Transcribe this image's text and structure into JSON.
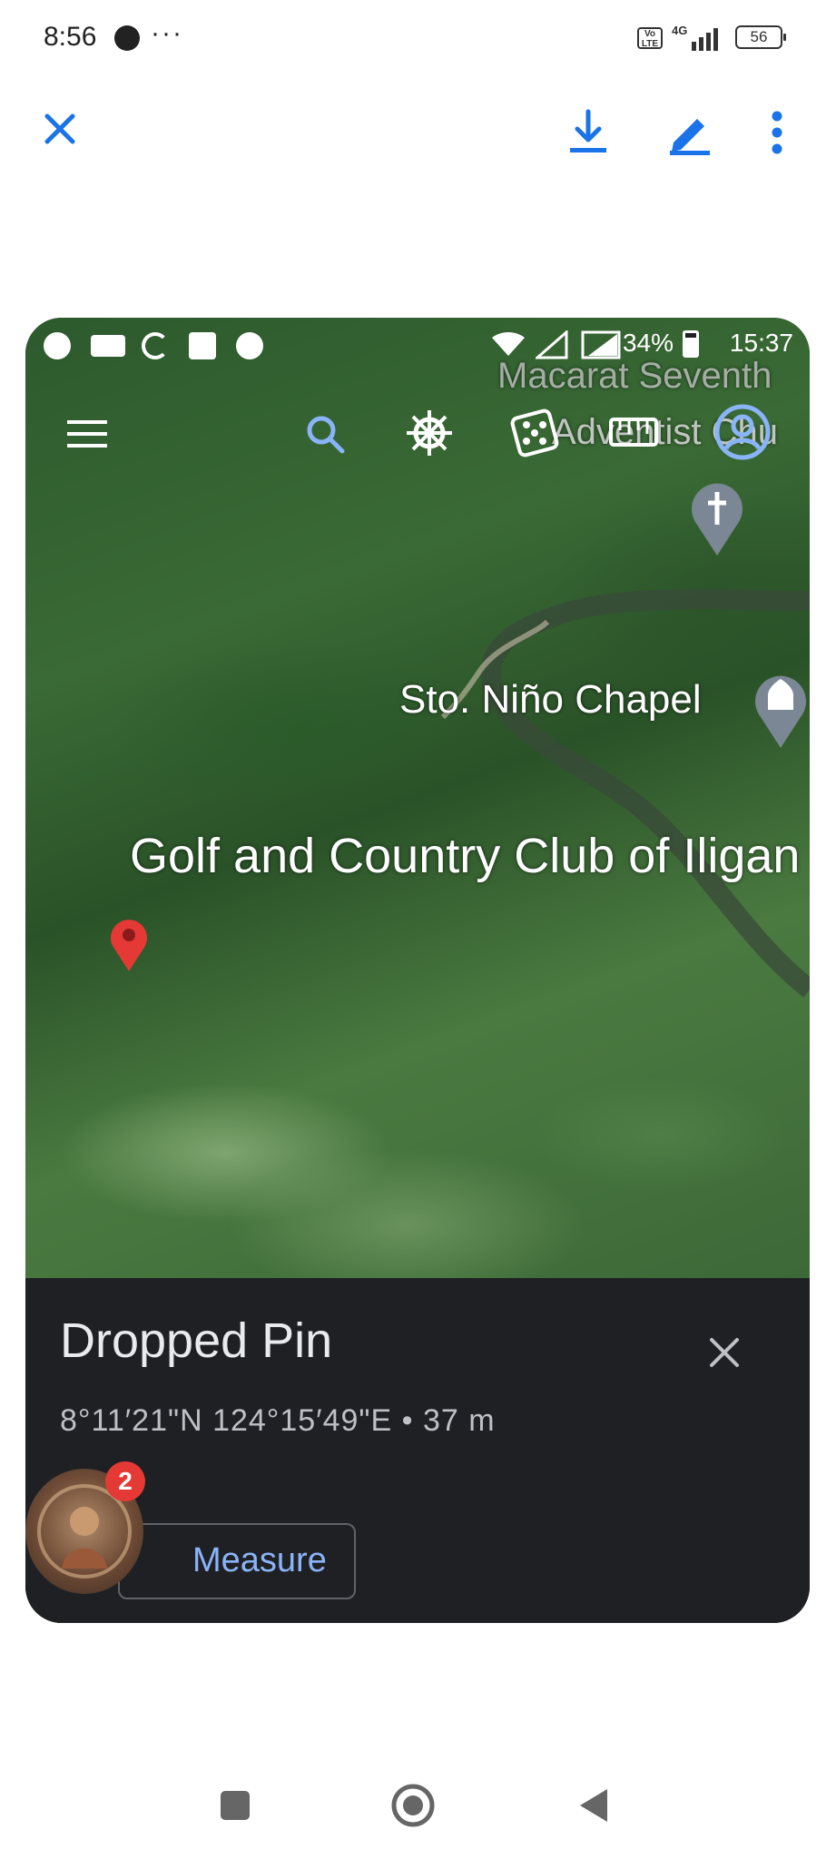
{
  "status_bar": {
    "time": "8:56",
    "overflow": "···",
    "volte": "Vo\nLTE",
    "network": "4G",
    "battery": "56"
  },
  "viewer_toolbar": {
    "close_icon": "close-icon",
    "download_icon": "download-icon",
    "edit_icon": "edit-icon",
    "more_icon": "more-vert-icon",
    "accent_color": "#1a73e8"
  },
  "embedded_screenshot": {
    "inner_status": {
      "battery": "34%",
      "time": "15:37"
    },
    "map_labels": {
      "macarat": "Macarat Seventh",
      "adventist": "Adventist Chu",
      "chapel": "Sto. Niño Chapel",
      "golf": "Golf and Country Club of Iligan"
    },
    "map_toolbar": [
      "menu-icon",
      "search-icon",
      "voyager-wheel-icon",
      "dice-icon",
      "ruler-icon",
      "account-icon"
    ],
    "pin_color": "#e53935",
    "info_sheet": {
      "title": "Dropped Pin",
      "coords": "8°11′21\"N 124°15′49\"E • 37 m",
      "measure_label": "Measure"
    },
    "chat_head_badge": "2"
  }
}
